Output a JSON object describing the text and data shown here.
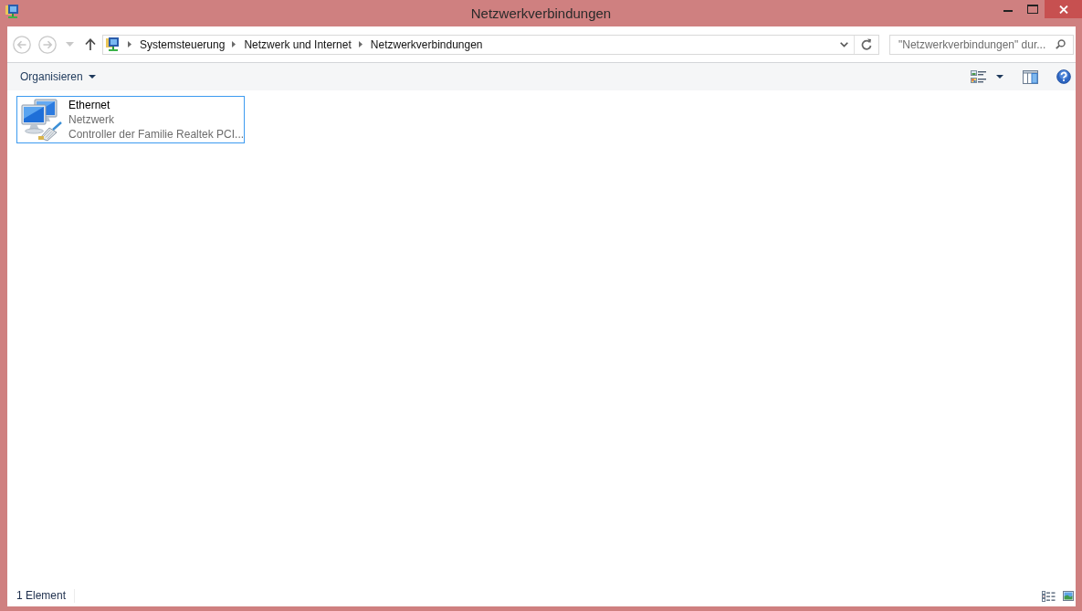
{
  "window": {
    "title": "Netzwerkverbindungen"
  },
  "navigation": {
    "back": {
      "disabled": true
    },
    "forward": {
      "disabled": true
    },
    "recent": {
      "disabled": true
    },
    "up": {
      "disabled": false
    }
  },
  "address_bar": {
    "crumbs": [
      "Systemsteuerung",
      "Netzwerk und Internet",
      "Netzwerkverbindungen"
    ]
  },
  "search": {
    "placeholder": "\"Netzwerkverbindungen\" dur..."
  },
  "toolbar": {
    "organize": "Organisieren"
  },
  "connections": [
    {
      "name": "Ethernet",
      "status": "Netzwerk",
      "adapter": "Controller der Familie Realtek PCI...",
      "selected": true
    }
  ],
  "status_bar": {
    "item_count": "1 Element"
  }
}
